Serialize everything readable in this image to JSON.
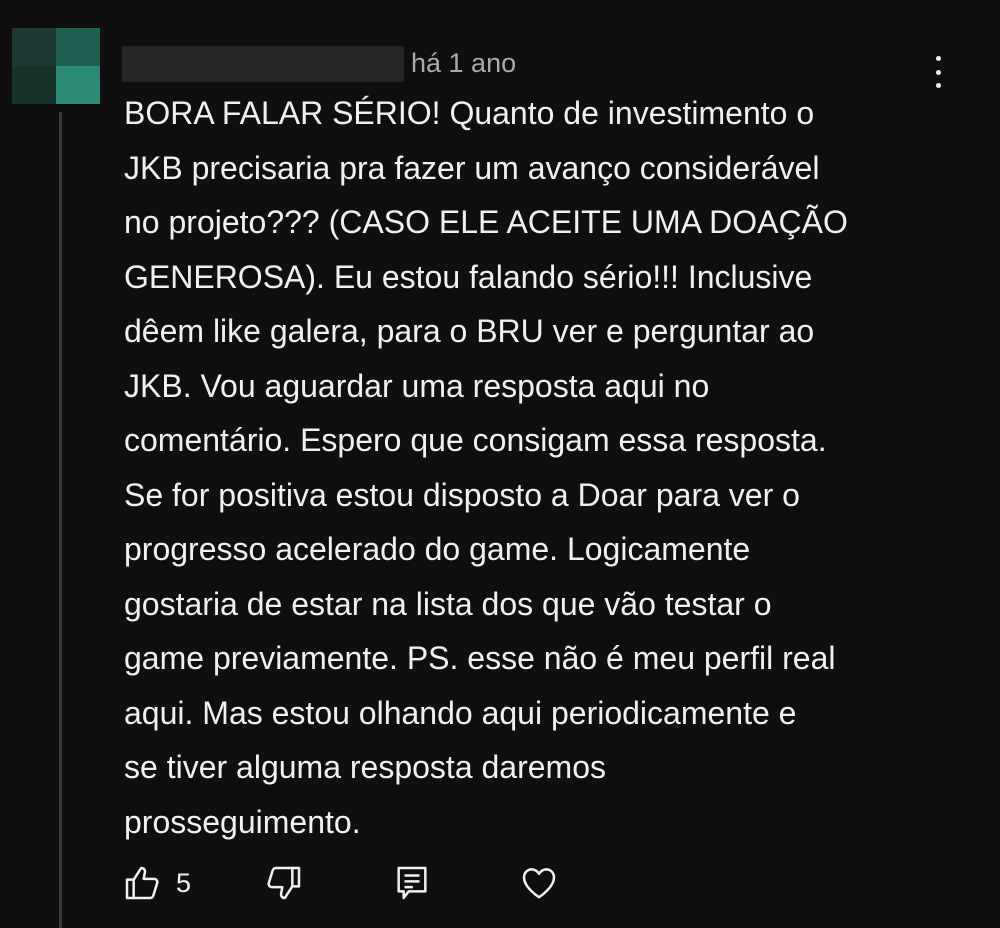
{
  "comment": {
    "timestamp": "há 1 ano",
    "text": "BORA FALAR SÉRIO! Quanto de investimento  o\nJKB precisaria pra fazer um avanço considerável\nno projeto??? (CASO ELE ACEITE UMA DOAÇÃO\nGENEROSA). Eu estou falando sério!!! Inclusive\ndêem like galera, para o BRU ver e perguntar ao\nJKB. Vou aguardar uma resposta aqui no\ncomentário. Espero que consigam essa resposta.\nSe for positiva estou disposto a Doar para ver o\nprogresso acelerado do game. Logicamente\ngostaria de estar na lista dos que vão testar o\ngame previamente. PS. esse não é meu perfil real\naqui. Mas estou olhando aqui periodicamente e\nse tiver alguma resposta daremos\nprosseguimento.",
    "like_count": "5"
  },
  "icons": {
    "avatar": "pixelated-avatar",
    "more": "more-vertical-icon",
    "like": "thumb-up-icon",
    "dislike": "thumb-down-icon",
    "reply": "comment-reply-icon",
    "heart": "heart-icon"
  },
  "colors": {
    "background": "#0f0f0f",
    "text": "#f1f1f1",
    "secondary_text": "#aaaaaa",
    "avatar_accent": "#2a8a76"
  }
}
